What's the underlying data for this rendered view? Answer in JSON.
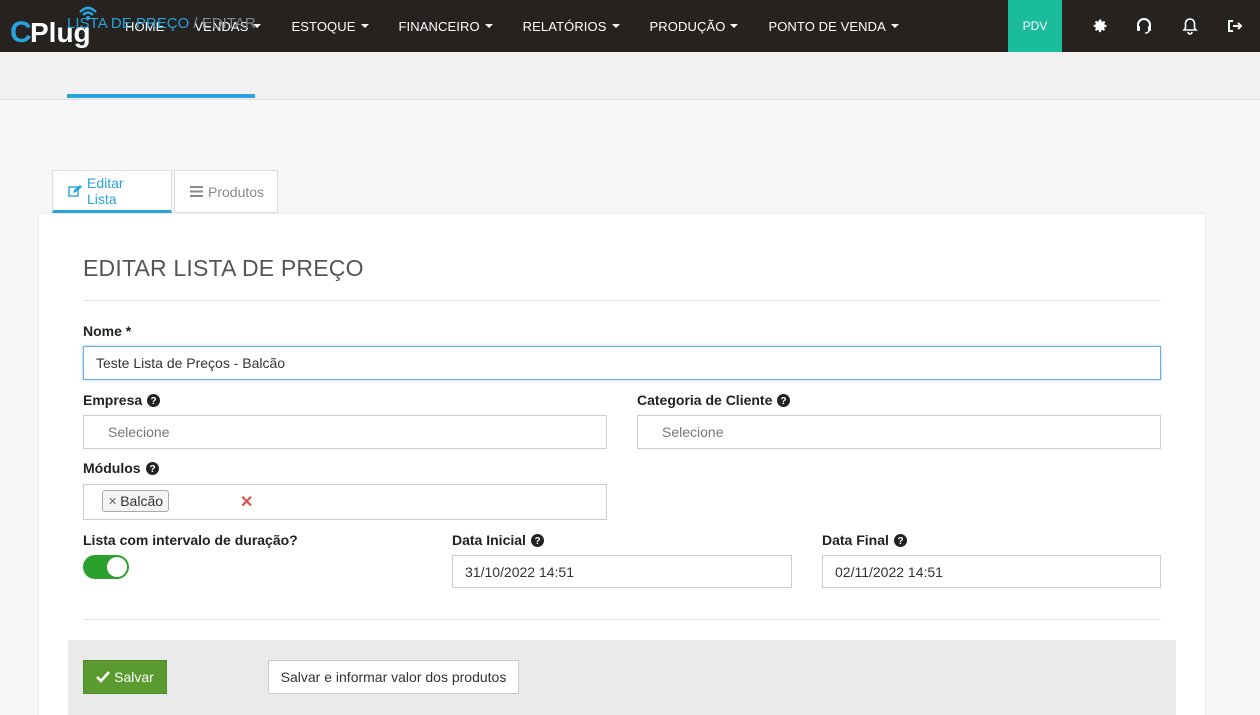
{
  "brand": {
    "logo_text": "CPlug"
  },
  "nav": {
    "items": [
      {
        "label": "HOME",
        "caret": false
      },
      {
        "label": "VENDAS",
        "caret": true
      },
      {
        "label": "ESTOQUE",
        "caret": true
      },
      {
        "label": "FINANCEIRO",
        "caret": true
      },
      {
        "label": "RELATÓRIOS",
        "caret": true
      },
      {
        "label": "PRODUÇÃO",
        "caret": true
      },
      {
        "label": "PONTO DE VENDA",
        "caret": true
      }
    ],
    "pdv_label": "PDV",
    "icons": [
      "gear-icon",
      "headset-icon",
      "bell-icon",
      "logout-icon"
    ]
  },
  "breadcrumb": {
    "link": "LISTA DE PREÇO",
    "separator": " / ",
    "current": "EDITAR"
  },
  "tabs": {
    "edit_label": "Editar Lista",
    "products_label": "Produtos"
  },
  "form": {
    "title": "EDITAR LISTA DE PREÇO",
    "nome_label": "Nome *",
    "nome_value": "Teste Lista de Preços - Balcão",
    "empresa_label": "Empresa",
    "empresa_placeholder": "Selecione",
    "categoria_label": "Categoria de Cliente",
    "categoria_placeholder": "Selecione",
    "modulos_label": "Módulos",
    "modulos_tag": "Balcão",
    "intervalo_label": "Lista com intervalo de duração?",
    "intervalo_on": true,
    "data_inicial_label": "Data Inicial",
    "data_inicial_value": "31/10/2022 14:51",
    "data_final_label": "Data Final",
    "data_final_value": "02/11/2022 14:51"
  },
  "actions": {
    "save_label": "Salvar",
    "save_products_label": "Salvar e informar valor dos produtos"
  },
  "colors": {
    "navbar": "#262220",
    "accent": "#29a3db",
    "pdv": "#1abc9c",
    "save": "#5b9a2f",
    "toggle": "#2ca02c"
  }
}
